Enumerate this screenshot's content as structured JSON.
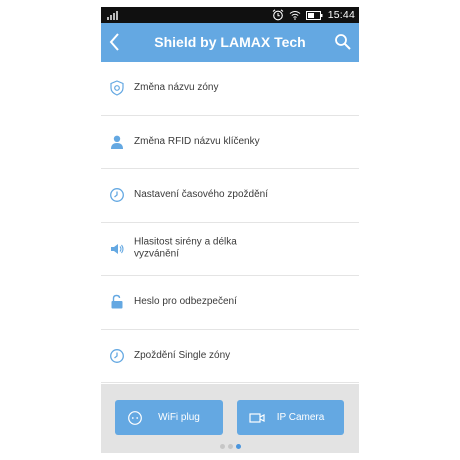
{
  "status_bar": {
    "time": "15:44"
  },
  "app_bar": {
    "title": "Shield by LAMAX Tech"
  },
  "menu": [
    {
      "icon": "shield-gear-icon",
      "label": "Změna názvu zóny"
    },
    {
      "icon": "person-icon",
      "label": "Změna RFID názvu klíčenky"
    },
    {
      "icon": "clock-icon",
      "label": "Nastavení časového zpoždění"
    },
    {
      "icon": "speaker-icon",
      "label": "Hlasitost sirény a délka vyzvánění"
    },
    {
      "icon": "unlocked-padlock-icon",
      "label": "Heslo pro odbezpečení"
    },
    {
      "icon": "clock-icon",
      "label": "Zpoždění Single zóny"
    }
  ],
  "footer": {
    "buttons": [
      {
        "icon": "plug-icon",
        "label": "WiFi plug"
      },
      {
        "icon": "camera-icon",
        "label": "IP Camera"
      }
    ],
    "page_indicator": {
      "count": 3,
      "active": 3
    }
  },
  "colors": {
    "accent": "#64a8e2",
    "status_bar": "#101010",
    "footer": "#e3e3e3",
    "divider": "#e4e4e4"
  }
}
